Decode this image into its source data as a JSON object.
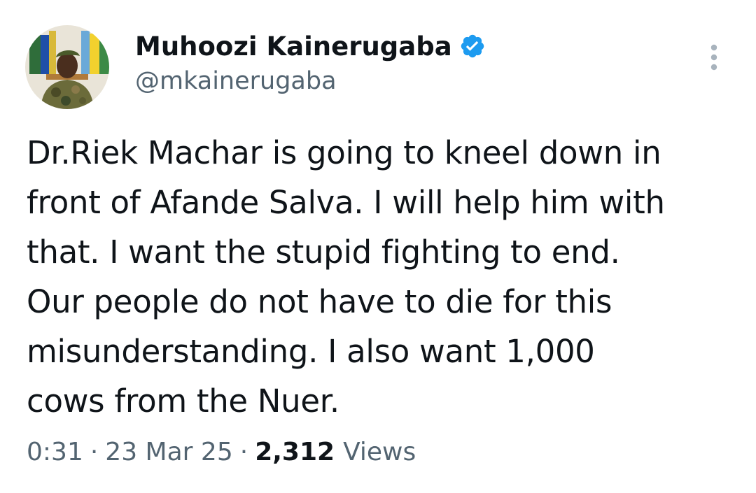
{
  "author": {
    "display_name": "Muhoozi Kainerugaba",
    "handle": "@mkainerugaba",
    "verified": true,
    "verified_color": "#1d9bf0"
  },
  "tweet": {
    "text": "Dr.Riek Machar is going to kneel down in\nfront of Afande Salva. I will help him with\nthat. I want the stupid fighting to end.\nOur people do not have to die for this\nmisunderstanding. I also want 1,000\ncows from the Nuer."
  },
  "meta": {
    "time": "0:31",
    "separator": "·",
    "date": "23 Mar 25",
    "views_count": "2,312",
    "views_label": "Views"
  },
  "icons": {
    "verified": "verified-badge-icon",
    "more": "more-options-icon"
  },
  "colors": {
    "text_primary": "#0f1419",
    "text_secondary": "#536471",
    "background": "#ffffff"
  }
}
